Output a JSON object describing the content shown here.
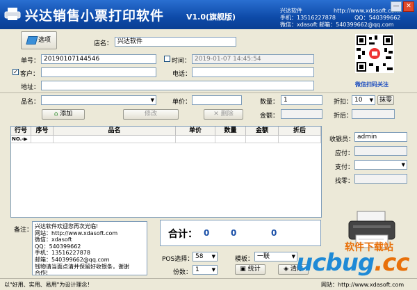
{
  "titlebar": {
    "title": "兴达销售小票打印软件",
    "version": "V1.0(旗舰版)",
    "info_line1_label": "兴达软件",
    "info_line1_url": "http://www.xdasoft.com",
    "info_line2": "手机：13516227878",
    "info_line2b": "QQ：540399662",
    "info_line3": "微信：xdasoft 邮箱：540399662@qq.com"
  },
  "form": {
    "options_button": "选项",
    "store_label": "店名：",
    "store_value": "兴达软件",
    "order_label": "单号：",
    "order_value": "20190107144546",
    "time_label": "时间：",
    "time_value": "2019-01-07 14:45:54",
    "customer_label": "客户：",
    "customer_value": "",
    "phone_label": "电话：",
    "phone_value": "",
    "address_label": "地址：",
    "address_value": "",
    "qr_caption": "微信扫码关注"
  },
  "item": {
    "name_label": "品名：",
    "price_label": "单价：",
    "qty_label": "数量：",
    "qty_value": "1",
    "amount_label": "金额：",
    "discount_label": "折扣：",
    "discount_value": "10",
    "change_button": "抹零",
    "after_discount_label": "折后：",
    "add_button": "添加",
    "edit_button": "修改",
    "delete_button": "删除"
  },
  "table": {
    "headers": [
      "行号",
      "序号",
      "品名",
      "单价",
      "数量",
      "金额",
      "折后"
    ],
    "row_marker": "NO.-▶"
  },
  "side": {
    "cashier_label": "收银员：",
    "cashier_value": "admin",
    "due_label": "应付：",
    "pay_label": "支付：",
    "change_label": "找零："
  },
  "bottom": {
    "remark_label": "备注：",
    "remark_text": "兴达软件欢迎您再次光临!\n网站：http://www.xdasoft.com\n微信：xdasoft\nQQ：540399662\n手机：13516227878\n邮箱：540399662@qq.com\n钱物请当面点清并保留好收银条，谢谢\n合作!",
    "total_label": "合计：",
    "total_qty": "0",
    "total_amount": "0",
    "total_after": "0",
    "pos_label": "POS选择：",
    "pos_value": "58",
    "template_label": "模板：",
    "template_value": "一联",
    "copies_label": "份数：",
    "copies_value": "1",
    "stats_button": "统计",
    "clear_button": "清除"
  },
  "status": {
    "left": "以\"好用、实用、易用\"为设计理念！",
    "right": "网站：http://www.xdasoft.com"
  },
  "watermark": {
    "name": "软件下载站",
    "domain": "ucbug.cc"
  }
}
